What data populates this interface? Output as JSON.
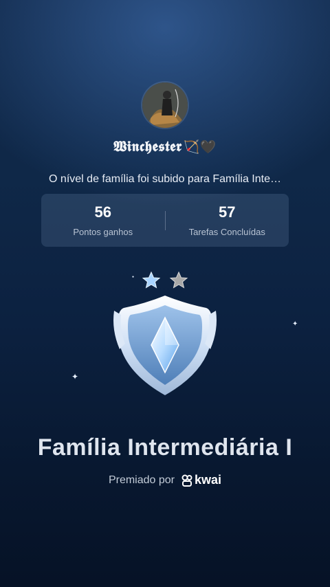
{
  "profile": {
    "username": "𝖂𝖎𝖓𝖈𝖍𝖊𝖘𝖙𝖊𝖗",
    "username_emoji": "🏹🖤"
  },
  "message": "O nível de família foi subido para Família Inte…",
  "stats": [
    {
      "value": "56",
      "label": "Pontos ganhos"
    },
    {
      "value": "57",
      "label": "Tarefas Concluídas"
    }
  ],
  "badge": {
    "stars_total": 2,
    "stars_filled": 1,
    "icon": "shield-diamond-icon"
  },
  "level_title": "Família Intermediária I",
  "awarded_by_label": "Premiado por",
  "brand": {
    "name": "kwai",
    "icon": "kwai-logo-icon"
  },
  "colors": {
    "accent_blue": "#9fd0ff",
    "background": "#0c2140"
  }
}
